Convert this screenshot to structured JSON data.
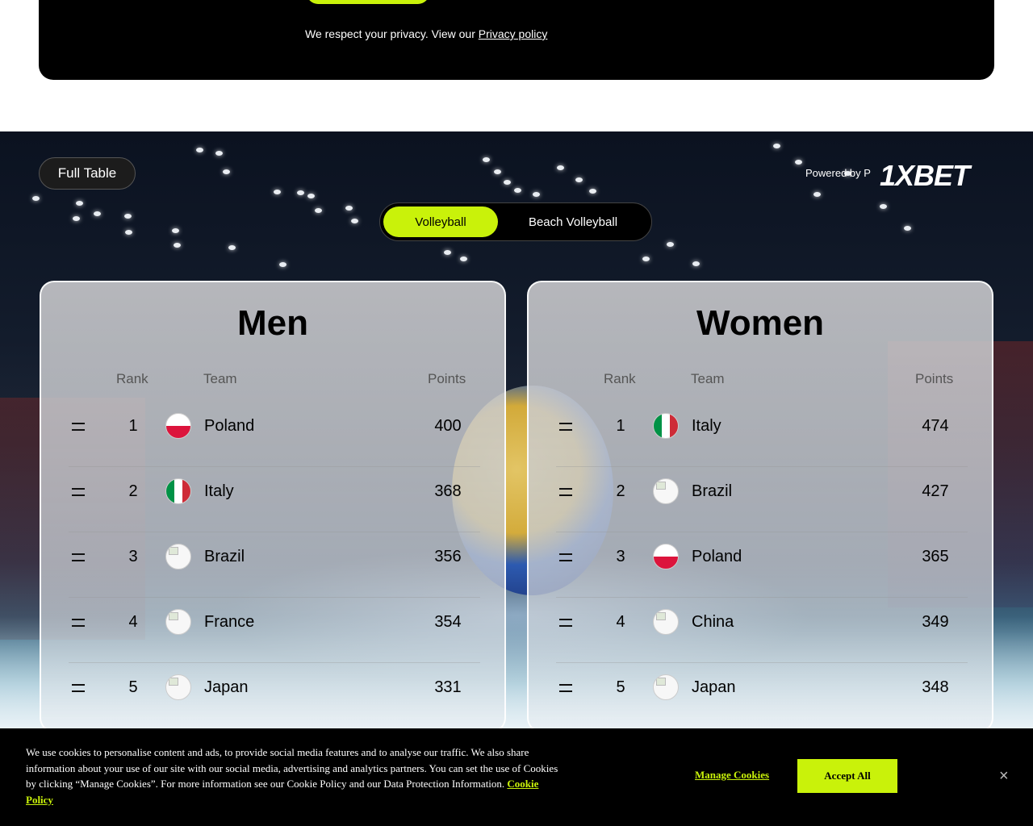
{
  "top_banner": {
    "privacy_text": "We respect your privacy. View our ",
    "privacy_link": "Privacy policy"
  },
  "header": {
    "full_table": "Full Table",
    "powered_by": "Powered by P",
    "logo": "1XBET"
  },
  "sport_toggle": {
    "options": [
      "Volleyball",
      "Beach Volleyball"
    ],
    "selected": "Volleyball"
  },
  "columns": {
    "rank": "Rank",
    "team": "Team",
    "points": "Points"
  },
  "men": {
    "title": "Men",
    "rows": [
      {
        "rank": "1",
        "team": "Poland",
        "points": "400",
        "flag": "poland-flag"
      },
      {
        "rank": "2",
        "team": "Italy",
        "points": "368",
        "flag": "italy-flag"
      },
      {
        "rank": "3",
        "team": "Brazil",
        "points": "356",
        "flag": "broken-image"
      },
      {
        "rank": "4",
        "team": "France",
        "points": "354",
        "flag": "broken-image"
      },
      {
        "rank": "5",
        "team": "Japan",
        "points": "331",
        "flag": "broken-image"
      }
    ]
  },
  "women": {
    "title": "Women",
    "rows": [
      {
        "rank": "1",
        "team": "Italy",
        "points": "474",
        "flag": "italy-flag"
      },
      {
        "rank": "2",
        "team": "Brazil",
        "points": "427",
        "flag": "broken-image"
      },
      {
        "rank": "3",
        "team": "Poland",
        "points": "365",
        "flag": "poland-flag"
      },
      {
        "rank": "4",
        "team": "China",
        "points": "349",
        "flag": "broken-image"
      },
      {
        "rank": "5",
        "team": "Japan",
        "points": "348",
        "flag": "broken-image"
      }
    ]
  },
  "cookie": {
    "text": "We use cookies to personalise content and ads, to provide social media features and to analyse our traffic. We also share information about your use of our site with our social media, advertising and analytics partners. You can set the use of Cookies by clicking “Manage Cookies”. For more information see our Cookie Policy and our Data Protection Information. ",
    "policy_link": "Cookie Policy",
    "manage": "Manage Cookies",
    "accept": "Accept All",
    "close": "×"
  },
  "colors": {
    "accent": "#c9f20a",
    "background": "#000000"
  }
}
